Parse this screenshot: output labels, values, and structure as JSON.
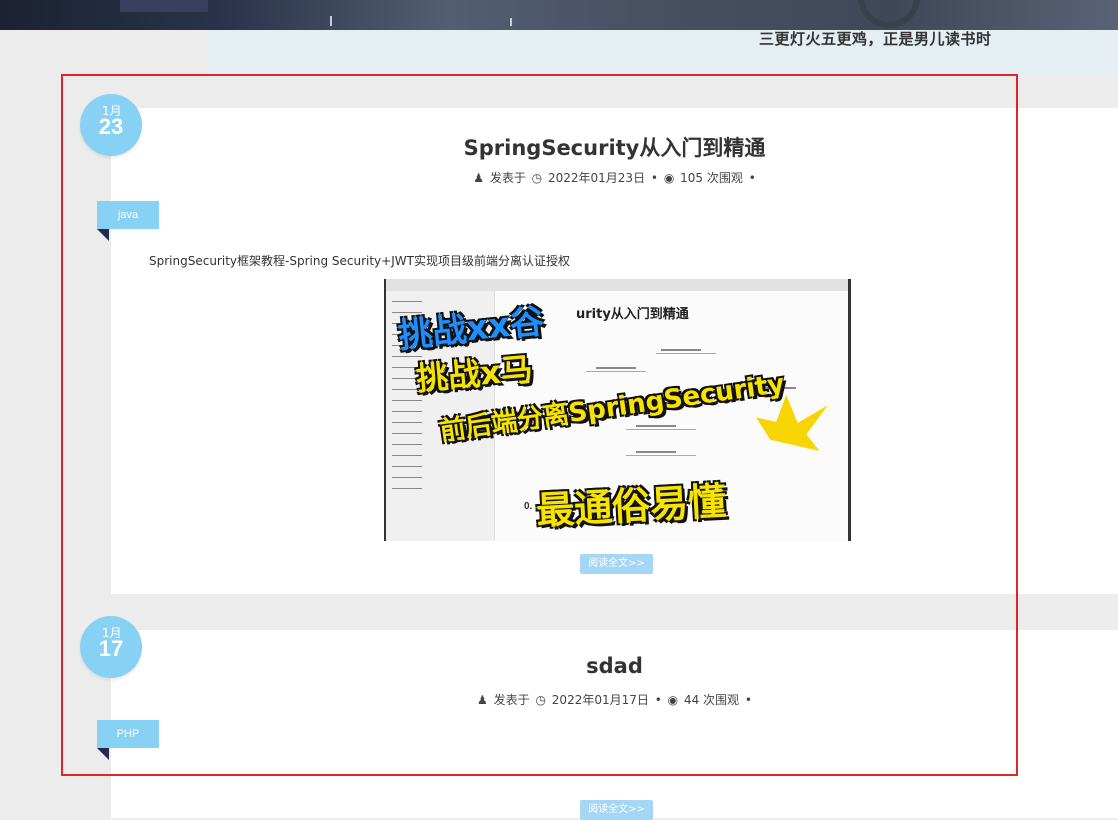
{
  "header": {
    "motto": "三更灯火五更鸡，正是男儿读书时"
  },
  "posts": [
    {
      "date_month": "1月",
      "date_day": "23",
      "category": "java",
      "title": "SpringSecurity从入门到精通",
      "author_label": "发表于",
      "date_full": "2022年01月23日",
      "views": "105 次围观",
      "excerpt": "SpringSecurity框架教程-Spring Security+JWT实现项目级前端分离认证授权",
      "thumbnail": {
        "mindmap_title": "urity从入门到精通",
        "overlay_1": "挑战xx谷",
        "overlay_2": "挑战x马",
        "overlay_3": "前后端分离SpringSecurity",
        "overlay_4": "最通俗易懂",
        "footer_text": "0."
      },
      "read_more": "阅读全文>>"
    },
    {
      "date_month": "1月",
      "date_day": "17",
      "category": "PHP",
      "title": "sdad",
      "author_label": "发表于",
      "date_full": "2022年01月17日",
      "views": "44 次围观",
      "read_more": "阅读全文>>"
    }
  ],
  "icons": {
    "user": "user-icon",
    "clock": "clock-icon",
    "eye": "eye-icon"
  },
  "colors": {
    "accent": "#86d1f4",
    "button": "#a6d6f5",
    "ribbon_fold": "#222b4a",
    "annotation": "#e0242b"
  }
}
